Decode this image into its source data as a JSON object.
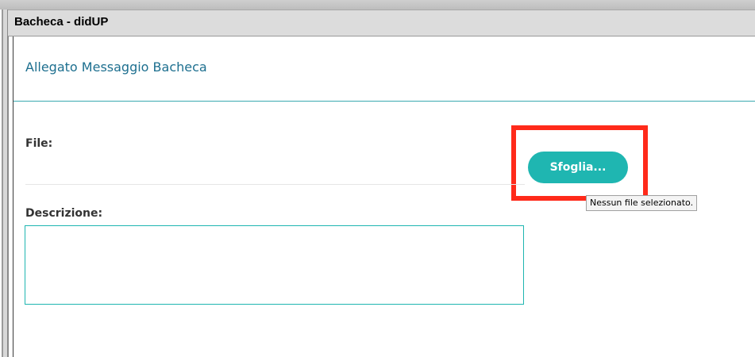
{
  "window": {
    "title": "Bacheca - didUP"
  },
  "panel": {
    "title": "Allegato Messaggio Bacheca"
  },
  "form": {
    "file_label": "File:",
    "browse_button_label": "Sfoglia...",
    "file_status_tooltip": "Nessun file selezionato.",
    "description_label": "Descrizione:",
    "description_value": ""
  },
  "colors": {
    "accent": "#1fb6b1",
    "title_text": "#1d6f8f",
    "highlight": "#ff2a1a"
  }
}
